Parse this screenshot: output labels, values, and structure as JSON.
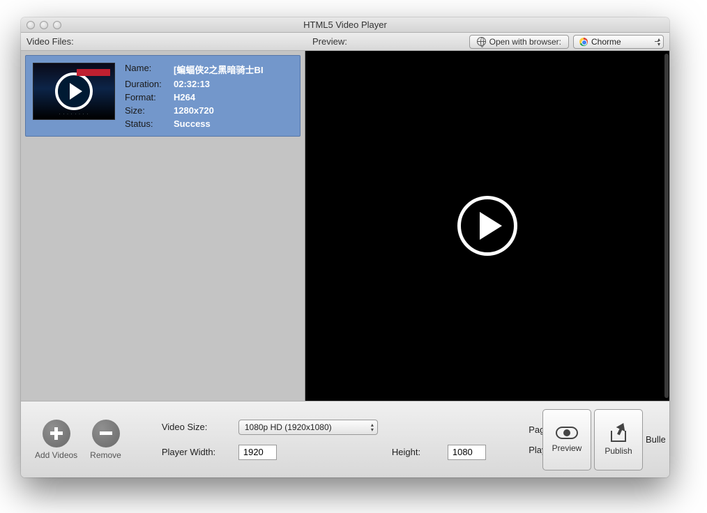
{
  "window": {
    "title": "HTML5 Video Player"
  },
  "toolbar": {
    "video_files_label": "Video Files:",
    "preview_label": "Preview:",
    "open_browser_label": "Open with browser:",
    "browser_selected": "Chorme"
  },
  "video_item": {
    "labels": {
      "name": "Name:",
      "duration": "Duration:",
      "format": "Format:",
      "size": "Size:",
      "status": "Status:"
    },
    "values": {
      "name": "[蝙蝠侠2之黑暗骑士BI",
      "duration": "02:32:13",
      "format": "H264",
      "size": "1280x720",
      "status": "Success"
    }
  },
  "bottom": {
    "add_videos": "Add Videos",
    "remove": "Remove",
    "video_size_label": "Video Size:",
    "video_size_value": "1080p HD (1920x1080)",
    "player_width_label": "Player Width:",
    "player_width_value": "1920",
    "height_label": "Height:",
    "height_value": "1080",
    "page_theme_label": "Page Theme:",
    "player_skin_label": "Player Skin:",
    "preview_btn": "Preview",
    "publish_btn": "Publish",
    "bullet_trail": "Bullet"
  }
}
